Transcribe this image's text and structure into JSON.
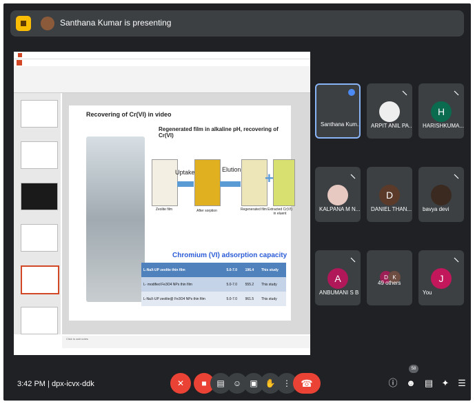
{
  "header": {
    "presenter_text": "Santhana Kumar is presenting"
  },
  "slide": {
    "title": "Recovering of Cr(VI) in video",
    "subtitle": "Regenerated film in alkaline pH, recovering of Cr(VI)",
    "uptake_label": "Uptake",
    "elution_label": "Elution",
    "captions": [
      "Zeolite film",
      "After sorption",
      "Regenerated film",
      "Extracted Cr(VI) in eluent"
    ],
    "table_heading": "Chromium (VI) adsorption capacity",
    "table_rows": [
      {
        "material": "L-NaX-UP zeolite thin film",
        "ph": "5.0-7.0",
        "capacity": "196.4",
        "ref": "This study"
      },
      {
        "material": "L- modified Fe3O4 NPs thin film",
        "ph": "5.0-7.0",
        "capacity": "555.2",
        "ref": "This study"
      },
      {
        "material": "L-NaX-UP zeolite@ Fe3O4 NPs thin film",
        "ph": "5.0-7.0",
        "capacity": "961.5",
        "ref": "This study"
      }
    ],
    "notes_placeholder": "Click to add notes"
  },
  "participants": [
    {
      "name": "Santhana Kum...",
      "color": "#6b4a3a",
      "initial": ""
    },
    {
      "name": "ARPIT ANIL PA...",
      "color": "#eeeeee",
      "initial": ""
    },
    {
      "name": "HARISHKUMA...",
      "color": "#0b6b4f",
      "initial": "H"
    },
    {
      "name": "KALPANA M N...",
      "color": "#e8c9c2",
      "initial": ""
    },
    {
      "name": "DANIEL THAN...",
      "color": "#5b3a2a",
      "initial": "D"
    },
    {
      "name": "bavya devi",
      "color": "#3a2a20",
      "initial": ""
    },
    {
      "name": "ANBUMANI S B",
      "color": "#b0185a",
      "initial": "A"
    },
    {
      "name": "49 others",
      "color": "#9c1f55",
      "initial": "D"
    },
    {
      "name": "You",
      "color": "#c2185b",
      "initial": "J"
    }
  ],
  "others_second_initial": "K",
  "footer": {
    "time": "3:42 PM",
    "separator": "|",
    "meeting_code": "dpx-icvx-ddk",
    "people_count": "58"
  }
}
